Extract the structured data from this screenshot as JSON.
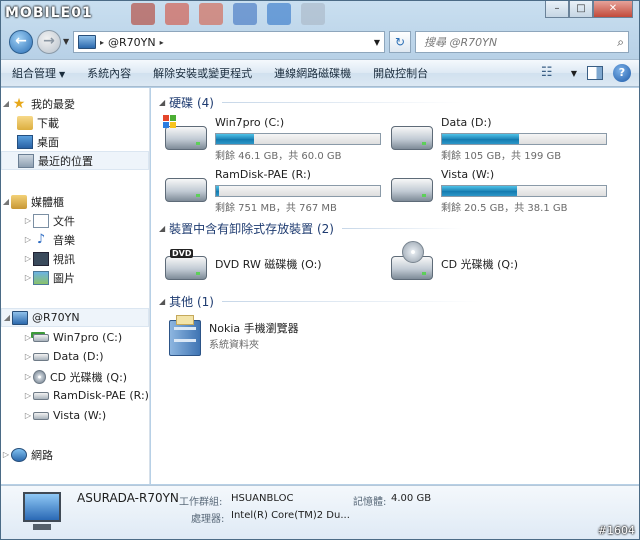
{
  "watermark": "MOBILE01",
  "caption": {
    "minimize": "–",
    "maximize": "□",
    "close": "✕"
  },
  "address": {
    "path": "@R70YN",
    "sep": "▸"
  },
  "search": {
    "placeholder": "搜尋 @R70YN"
  },
  "commands": [
    {
      "label": "組合管理",
      "dropdown": true
    },
    {
      "label": "系統內容",
      "dropdown": false
    },
    {
      "label": "解除安裝或變更程式",
      "dropdown": false
    },
    {
      "label": "連線網路磁碟機",
      "dropdown": false
    },
    {
      "label": "開啟控制台",
      "dropdown": false
    }
  ],
  "nav": {
    "favorites": {
      "label": "我的最愛",
      "items": [
        "下載",
        "桌面",
        "最近的位置"
      ]
    },
    "libraries": {
      "label": "媒體櫃",
      "items": [
        "文件",
        "音樂",
        "視訊",
        "圖片"
      ]
    },
    "computer": {
      "label": "@R70YN",
      "items": [
        "Win7pro (C:)",
        "Data (D:)",
        "CD 光碟機 (Q:)",
        "RamDisk-PAE (R:)",
        "Vista (W:)"
      ]
    },
    "network": {
      "label": "網路"
    }
  },
  "groups": {
    "hdd": "硬碟 (4)",
    "removable": "裝置中含有卸除式存放裝置 (2)",
    "other": "其他 (1)"
  },
  "drives": [
    {
      "name": "Win7pro (C:)",
      "free": "剩餘 46.1 GB，共 60.0 GB",
      "used_fraction": 0.23,
      "icon": "windows-drive-icon"
    },
    {
      "name": "Data (D:)",
      "free": "剩餘 105 GB，共 199 GB",
      "used_fraction": 0.47,
      "icon": "hard-drive-icon"
    },
    {
      "name": "RamDisk-PAE (R:)",
      "free": "剩餘 751 MB，共 767 MB",
      "used_fraction": 0.02,
      "icon": "hard-drive-icon"
    },
    {
      "name": "Vista (W:)",
      "free": "剩餘 20.5 GB，共 38.1 GB",
      "used_fraction": 0.46,
      "icon": "hard-drive-icon"
    }
  ],
  "removable": [
    {
      "name": "DVD RW 磁碟機 (O:)",
      "badge": "DVD"
    },
    {
      "name": "CD 光碟機 (Q:)"
    }
  ],
  "other": [
    {
      "name": "Nokia 手機瀏覽器",
      "sub": "系統資料夾"
    }
  ],
  "details": {
    "name": "ASURADA-R70YN",
    "workgroup_label": "工作群組:",
    "workgroup": "HSUANBLOC",
    "memory_label": "記憶體:",
    "memory": "4.00 GB",
    "cpu_label": "處理器:",
    "cpu": "Intel(R) Core(TM)2 Du..."
  },
  "corner_tag": "#1604",
  "colors": {
    "bar_fill": "#1f86b8",
    "group_heading": "#1e3b70"
  }
}
